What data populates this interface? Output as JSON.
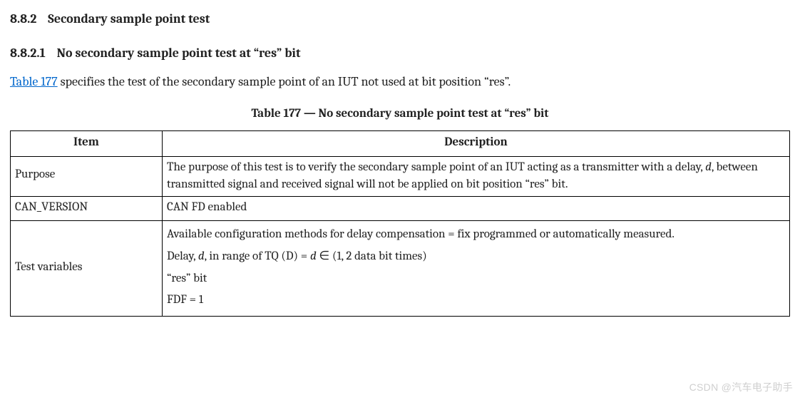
{
  "section": {
    "num1": "8.8.2",
    "title1": "Secondary sample point test",
    "num2": "8.8.2.1",
    "title2": "No secondary sample point test at “res” bit"
  },
  "intro": {
    "link": "Table 177",
    "rest": " specifies the test of the secondary sample point of an IUT not used at bit position “res”."
  },
  "caption": "Table 177 — No secondary sample point test at “res” bit",
  "headers": {
    "item": "Item",
    "desc": "Description"
  },
  "rows": {
    "purpose": {
      "label": "Purpose",
      "text_pre": "The purpose of this test is to verify the secondary sample point of an IUT acting as a transmitter with a delay, ",
      "d1": "d",
      "text_post": ", between transmitted signal and received signal will not be applied on bit position “res” bit."
    },
    "can_version": {
      "label": "CAN_VERSION",
      "text": "CAN FD enabled"
    },
    "test_vars": {
      "label": "Test variables",
      "line1": "Available configuration methods for delay compensation = fix programmed or automatically measured.",
      "line2_pre": "Delay, ",
      "line2_d": "d",
      "line2_mid": ", in range of TQ (D) = ",
      "line2_d2": "d",
      "line2_post": " ∈ (1, 2 data bit times)",
      "line3": "“res” bit",
      "line4": "FDF = 1"
    }
  },
  "watermark": "CSDN @汽车电子助手"
}
